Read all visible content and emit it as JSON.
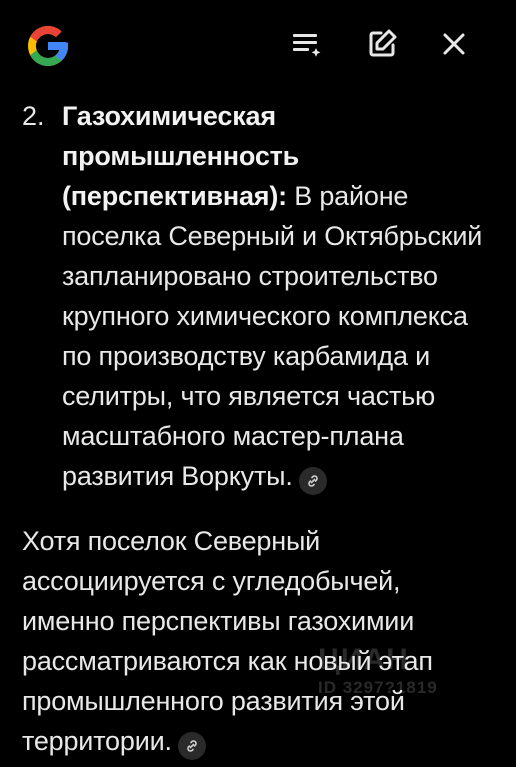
{
  "header": {
    "logo_icon": "google-g-logo",
    "actions": [
      {
        "icon": "playlist-add-icon"
      },
      {
        "icon": "edit-note-icon"
      },
      {
        "icon": "close-icon"
      }
    ]
  },
  "content": {
    "item": {
      "number": "2.",
      "title": "Газохимическая промышленность (перспективная):",
      "text": " В районе поселка Северный и Октябрьский запланировано строительство крупного химического комплекса по производству карбамида и селитры, что является частью масштабного мастер-плана развития Воркуты.",
      "citation_icon": "link-icon"
    },
    "paragraph": {
      "text": "Хотя поселок Северный ассоциируется с угледобычей, именно перспективы газохимии рассматриваются как новый этап промышленного развития этой территории.",
      "citation_icon": "link-icon"
    }
  },
  "watermark": {
    "logo": "ЦИАН",
    "id": "ID 3297?1819"
  },
  "colors": {
    "background": "#000000",
    "text": "#e8e8e8",
    "google_blue": "#4285F4",
    "google_red": "#EA4335",
    "google_yellow": "#FBBC05",
    "google_green": "#34A853"
  }
}
